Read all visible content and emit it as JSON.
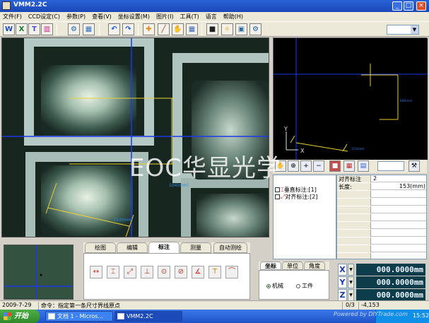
{
  "window": {
    "title": "VMM2.2C",
    "min": "_",
    "max": "□",
    "close": "×"
  },
  "menu": [
    "文件(F)",
    "CCD设定(C)",
    "参数(P)",
    "查看(V)",
    "坐标设置(M)",
    "图片(I)",
    "工具(T)",
    "语言",
    "帮助(H)"
  ],
  "toolbar": {
    "icons": [
      "word-icon",
      "excel-icon",
      "text-export-icon",
      "chart-icon",
      "calibrate-icon",
      "print-preview-icon",
      "undo-icon",
      "redo-icon",
      "crosshair-icon",
      "wand-icon",
      "hand-icon",
      "grid-icon",
      "camera-icon",
      "light-icon",
      "image-adjust-icon",
      "settings-icon"
    ],
    "glyphs": [
      "W",
      "X",
      "T",
      "▥",
      "⚙",
      "▦",
      "↶",
      "↷",
      "✚",
      "╱",
      "✋",
      "▦",
      "■",
      "☼",
      "▣",
      "⚙"
    ],
    "combo_value": ""
  },
  "camera": {
    "label_vertical": "104(mm)",
    "label_horizontal": "153(mm)"
  },
  "overview": {
    "axis_y": "Y",
    "axis_x": "X",
    "label_vertical": "104(mm)",
    "label_horizontal": "153(mm)"
  },
  "watermark_center": "EOC华显光学",
  "tree": {
    "items": [
      {
        "label": "垂直标注:[1]"
      },
      {
        "label": "对齐标注:[2]"
      }
    ]
  },
  "props": {
    "rows": [
      {
        "key": "对齐标注",
        "value": "2"
      },
      {
        "key": "长度:",
        "value": "153(mm)"
      }
    ]
  },
  "toolpanel": {
    "tabs": [
      "绘图",
      "编辑",
      "标注",
      "测量",
      "自动测绘"
    ],
    "active_tab": 2,
    "tools": [
      "↔",
      "⌶",
      "⤢",
      "⊥",
      "⊙",
      "⊘",
      "∡",
      "T",
      "⌒"
    ],
    "tool_icons": [
      "horizontal-dim-icon",
      "vertical-dim-icon",
      "aligned-dim-icon",
      "perpendicular-icon",
      "radius-icon",
      "diameter-icon",
      "angle-icon",
      "text-icon",
      "arc-icon"
    ]
  },
  "coordpanel": {
    "tabs": [
      "坐标",
      "单位",
      "角度"
    ],
    "radios": [
      {
        "label": "机械",
        "checked": true
      },
      {
        "label": "工件",
        "checked": false
      }
    ]
  },
  "readouts": [
    {
      "axis": "X",
      "value": "000.0000mm"
    },
    {
      "axis": "Y",
      "value": "000.0000mm"
    },
    {
      "axis": "Z",
      "value": "000.0000mm"
    }
  ],
  "status": {
    "date": "2009-7-29",
    "command": "命令：指定第一条尺寸界线原点",
    "index": "0/3",
    "coords": "-4,153"
  },
  "taskbar": {
    "start": "开始",
    "tasks": [
      {
        "label": "文档 1 - Micros..."
      },
      {
        "label": "VMM2.2C"
      }
    ],
    "clock": "15:52",
    "watermark": "Powered by DIYTrade.com"
  }
}
